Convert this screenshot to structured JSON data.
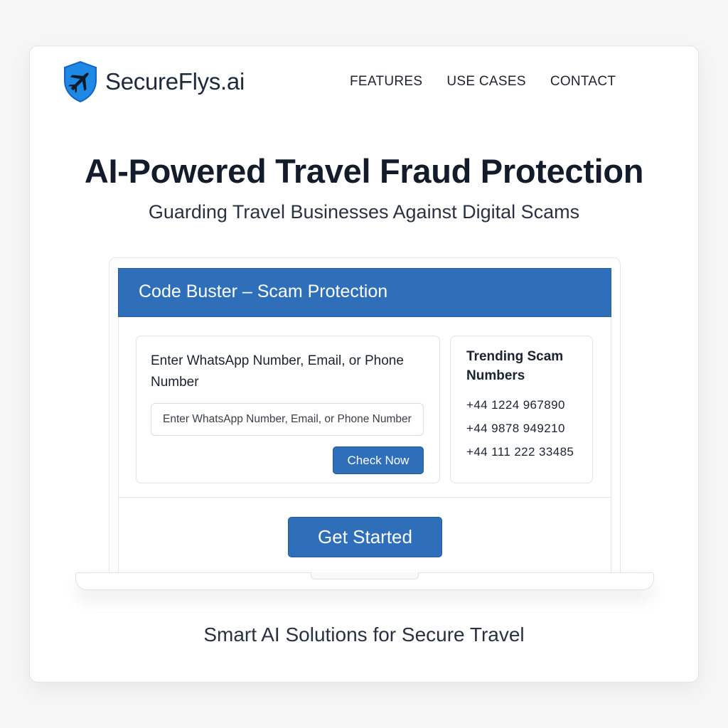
{
  "brand": {
    "name": "SecureFlys.ai",
    "logo_icon": "shield-plane-icon",
    "accent": "#1e88e5"
  },
  "nav": {
    "items": [
      {
        "label": "FEATURES"
      },
      {
        "label": "USE CASES"
      },
      {
        "label": "CONTACT"
      }
    ]
  },
  "hero": {
    "title": "AI-Powered Travel Fraud Protection",
    "subtitle": "Guarding Travel Businesses Against Digital Scams"
  },
  "app": {
    "header_title": "Code Buster – Scam Protection",
    "header_color": "#2f6fba",
    "lookup": {
      "label": "Enter WhatsApp Number, Email, or Phone Number",
      "placeholder": "Enter WhatsApp Number, Email, or Phone Number",
      "value": "",
      "button_label": "Check Now"
    },
    "trending": {
      "title": "Trending Scam Numbers",
      "numbers": [
        "+44 1224 967890",
        "+44 9878 949210",
        "+44 111 222 33485"
      ]
    },
    "cta_label": "Get Started"
  },
  "tagline": "Smart AI Solutions for Secure Travel"
}
